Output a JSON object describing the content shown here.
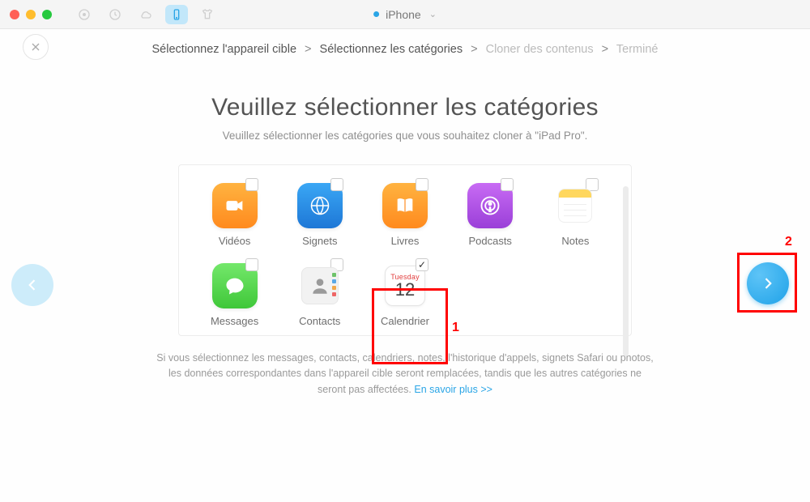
{
  "titlebar": {
    "device_name": "iPhone"
  },
  "breadcrumb": {
    "step1": "Sélectionnez l'appareil cible",
    "step2": "Sélectionnez les catégories",
    "step3": "Cloner des contenus",
    "step4": "Terminé",
    "sep": ">"
  },
  "header": {
    "title": "Veuillez sélectionner les catégories",
    "subtitle": "Veuillez sélectionner les catégories que vous souhaitez cloner à \"iPad Pro\"."
  },
  "categories": [
    {
      "label": "Vidéos",
      "icon": "video-icon",
      "checked": false
    },
    {
      "label": "Signets",
      "icon": "bookmark-icon",
      "checked": false
    },
    {
      "label": "Livres",
      "icon": "book-icon",
      "checked": false
    },
    {
      "label": "Podcasts",
      "icon": "podcast-icon",
      "checked": false
    },
    {
      "label": "Notes",
      "icon": "notes-icon",
      "checked": false
    },
    {
      "label": "Messages",
      "icon": "message-icon",
      "checked": false
    },
    {
      "label": "Contacts",
      "icon": "contacts-icon",
      "checked": false
    },
    {
      "label": "Calendrier",
      "icon": "calendar-icon",
      "checked": true,
      "calendar_day": "Tuesday",
      "calendar_num": "12"
    }
  ],
  "footnote": {
    "text": "Si vous sélectionnez les messages, contacts, calendriers, notes, l'historique d'appels, signets Safari ou photos, les données correspondantes dans l'appareil cible seront remplacées, tandis que les autres catégories ne seront pas affectées.",
    "link_label": "En savoir plus >>"
  },
  "annotations": {
    "label1": "1",
    "label2": "2"
  }
}
